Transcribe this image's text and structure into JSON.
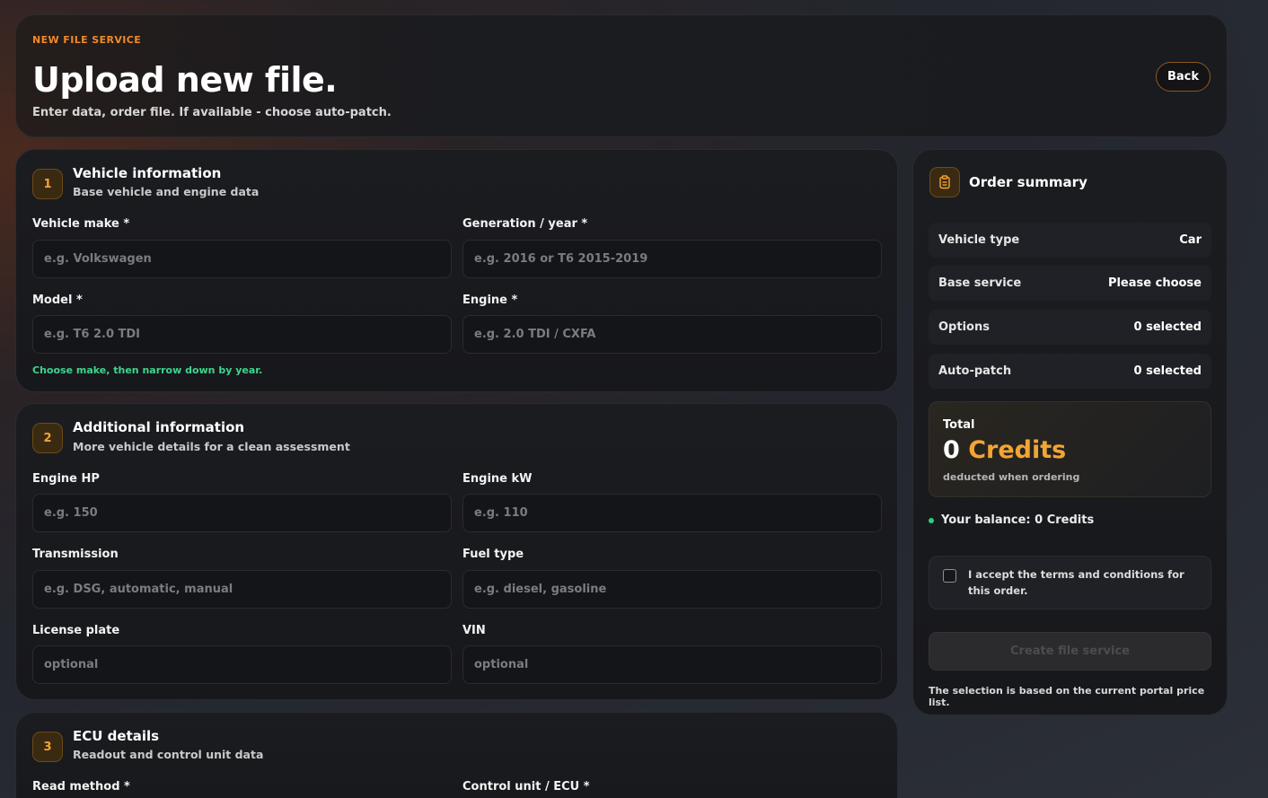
{
  "header": {
    "eyebrow": "NEW FILE SERVICE",
    "title": "Upload new file.",
    "subtitle": "Enter data, order file. If available - choose auto-patch.",
    "back_label": "Back"
  },
  "sections": [
    {
      "step": "1",
      "title": "Vehicle information",
      "subtitle": "Base vehicle and engine data",
      "fields": [
        {
          "label": "Vehicle make *",
          "placeholder": "e.g. Volkswagen"
        },
        {
          "label": "Generation / year *",
          "placeholder": "e.g. 2016 or T6 2015-2019"
        },
        {
          "label": "Model *",
          "placeholder": "e.g. T6 2.0 TDI"
        },
        {
          "label": "Engine *",
          "placeholder": "e.g. 2.0 TDI / CXFA"
        }
      ],
      "hint": "Choose make, then narrow down by year."
    },
    {
      "step": "2",
      "title": "Additional information",
      "subtitle": "More vehicle details for a clean assessment",
      "fields": [
        {
          "label": "Engine HP",
          "placeholder": "e.g. 150"
        },
        {
          "label": "Engine kW",
          "placeholder": "e.g. 110"
        },
        {
          "label": "Transmission",
          "placeholder": "e.g. DSG, automatic, manual"
        },
        {
          "label": "Fuel type",
          "placeholder": "e.g. diesel, gasoline"
        },
        {
          "label": "License plate",
          "placeholder": "optional"
        },
        {
          "label": "VIN",
          "placeholder": "optional"
        }
      ]
    },
    {
      "step": "3",
      "title": "ECU details",
      "subtitle": "Readout and control unit data",
      "fields": [
        {
          "label": "Read method *"
        },
        {
          "label": "Control unit / ECU *"
        }
      ]
    }
  ],
  "summary": {
    "title": "Order summary",
    "icon": "clipboard-icon",
    "rows": [
      {
        "key": "Vehicle type",
        "value": "Car"
      },
      {
        "key": "Base service",
        "value": "Please choose"
      },
      {
        "key": "Options",
        "value": "0 selected"
      },
      {
        "key": "Auto-patch",
        "value": "0 selected"
      }
    ],
    "total_label": "Total",
    "total_number": "0",
    "total_unit": "Credits",
    "total_note": "deducted when ordering",
    "balance": "Your balance: 0 Credits",
    "terms": "I accept the terms and conditions for this order.",
    "create_label": "Create file service",
    "price_note": "The selection is based on the current portal price list."
  },
  "colors": {
    "accent": "#f2a533",
    "eyebrow": "#f0892a",
    "hint": "#3fd48e",
    "balance_dot": "#2fcf7a"
  }
}
